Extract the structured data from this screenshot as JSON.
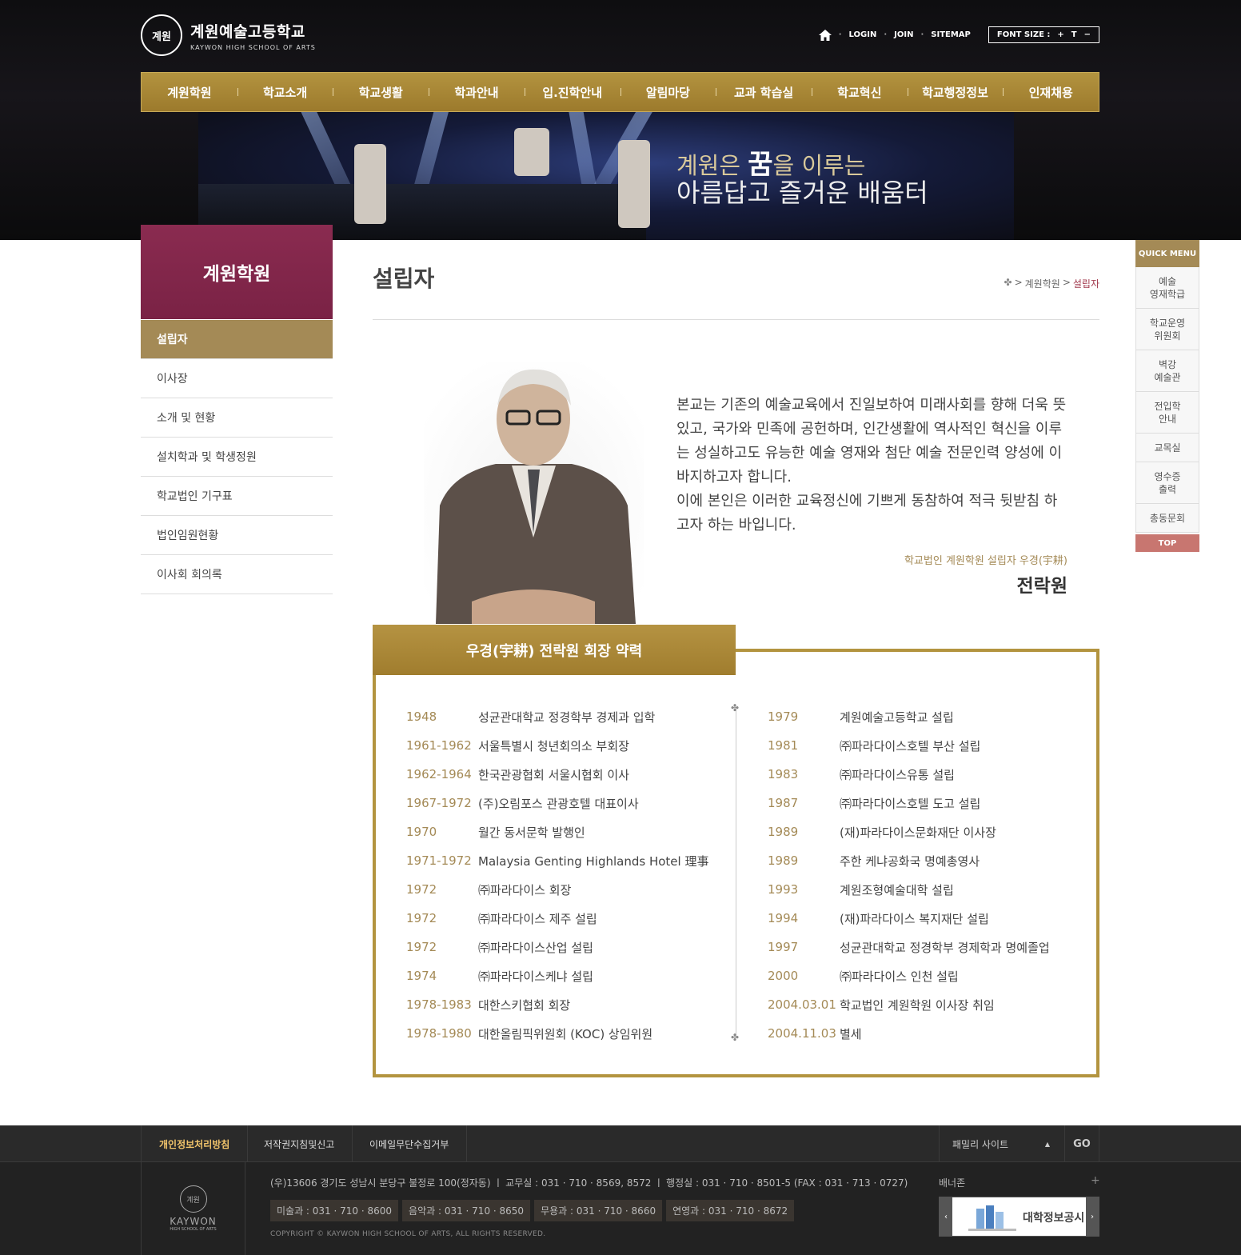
{
  "header": {
    "school_name": "계원예술고등학교",
    "school_name_en": "KAYWON HIGH SCHOOL OF ARTS",
    "emblem_text": "계원",
    "util": {
      "login": "LOGIN",
      "join": "JOIN",
      "sitemap": "SITEMAP",
      "font_size_label": "FONT SIZE :",
      "font_plus": "+",
      "font_reset": "T",
      "font_minus": "−"
    },
    "gnb": [
      "계원학원",
      "학교소개",
      "학교생활",
      "학과안내",
      "입.진학안내",
      "알림마당",
      "교과 학습실",
      "학교혁신",
      "학교행정정보",
      "인재채용"
    ],
    "hero_line1_a": "계원은 ",
    "hero_line1_b": "꿈",
    "hero_line1_c": "을 이루는",
    "hero_line2": "아름답고 즐거운 배움터"
  },
  "sidebar": {
    "title": "계원학원",
    "items": [
      "설립자",
      "이사장",
      "소개 및 현황",
      "설치학과 및 학생정원",
      "학교법인 기구표",
      "법인임원현황",
      "이사회 회의록"
    ],
    "active_index": 0
  },
  "page": {
    "title": "설립자",
    "breadcrumb": [
      ">",
      "계원학원",
      ">",
      "설립자"
    ]
  },
  "message": {
    "paragraph1": "본교는 기존의 예술교육에서 진일보하여 미래사회를 향해 더욱 뜻있고, 국가와 민족에 공헌하며, 인간생활에 역사적인 혁신을 이루는 성실하고도 유능한 예술 영재와 첨단 예술 전문인력 양성에 이바지하고자 합니다.",
    "paragraph2": "이에 본인은 이러한 교육정신에 기쁘게 동참하여 적극 뒷받침 하고자 하는 바입니다.",
    "signature_title": "학교법인 계원학원 설립자 우경(宇耕)",
    "signature_name": "전락원"
  },
  "career": {
    "title": "우경(宇耕) 전락원 회장 약력",
    "left": [
      {
        "year": "1948",
        "text": "성균관대학교 정경학부 경제과 입학"
      },
      {
        "year": "1961-1962",
        "text": "서울특별시 청년회의소 부회장"
      },
      {
        "year": "1962-1964",
        "text": "한국관광협회 서울시협회 이사"
      },
      {
        "year": "1967-1972",
        "text": "(주)오림포스 관광호텔 대표이사"
      },
      {
        "year": "1970",
        "text": "월간 동서문학 발행인"
      },
      {
        "year": "1971-1972",
        "text": "Malaysia Genting Highlands Hotel 理事"
      },
      {
        "year": "1972",
        "text": "㈜파라다이스 회장"
      },
      {
        "year": "1972",
        "text": "㈜파라다이스 제주 설립"
      },
      {
        "year": "1972",
        "text": "㈜파라다이스산업 설립"
      },
      {
        "year": "1974",
        "text": "㈜파라다이스케냐 설립"
      },
      {
        "year": "1978-1983",
        "text": "대한스키협회 회장"
      },
      {
        "year": "1978-1980",
        "text": "대한올림픽위원회 (KOC) 상임위원"
      }
    ],
    "right": [
      {
        "year": "1979",
        "text": "계원예술고등학교 설립"
      },
      {
        "year": "1981",
        "text": "㈜파라다이스호텔 부산 설립"
      },
      {
        "year": "1983",
        "text": "㈜파라다이스유통 설립"
      },
      {
        "year": "1987",
        "text": "㈜파라다이스호텔 도고 설립"
      },
      {
        "year": "1989",
        "text": "(재)파라다이스문화재단 이사장"
      },
      {
        "year": "1989",
        "text": "주한 케냐공화국 명예총영사"
      },
      {
        "year": "1993",
        "text": "계원조형예술대학 설립"
      },
      {
        "year": "1994",
        "text": "(재)파라다이스 복지재단 설립"
      },
      {
        "year": "1997",
        "text": "성균관대학교 정경학부 경제학과 명예졸업"
      },
      {
        "year": "2000",
        "text": "㈜파라다이스 인천 설립"
      },
      {
        "year": "2004.03.01",
        "text": "학교법인 계원학원 이사장 취임"
      },
      {
        "year": "2004.11.03",
        "text": "별세"
      }
    ]
  },
  "quick_menu": {
    "header": "QUICK MENU",
    "items": [
      "예술\n영재학급",
      "학교운영\n위원회",
      "벽강\n예술관",
      "전입학\n안내",
      "교목실",
      "영수증\n출력",
      "총동문회"
    ],
    "top": "TOP"
  },
  "footer": {
    "links": [
      "개인정보처리방침",
      "저작권지침및신고",
      "이메일무단수집거부"
    ],
    "family_site": "패밀리 사이트",
    "go": "GO",
    "logo_emblem": "계원",
    "logo_text": "KAYWON",
    "logo_sub": "HIGH SCHOOL OF ARTS",
    "address": "(우)13606 경기도 성남시 분당구 불정로 100(정자동)   ㅣ  교무실 : 031 · 710 · 8569, 8572   ㅣ  행정실 : 031 · 710 · 8501-5 (FAX : 031 · 713 · 0727)",
    "tels": [
      "미술과 : 031 · 710 · 8600",
      "음악과 : 031 · 710 · 8650",
      "무용과 : 031 · 710 · 8660",
      "연영과 : 031 · 710 · 8672"
    ],
    "copyright": "COPYRIGHT © KAYWON HIGH SCHOOL OF ARTS, ALL RIGHTS RESERVED.",
    "banner_zone": "배너존",
    "banner_plus": "+",
    "banner_text": "대학정보공시",
    "banner_prev": "‹",
    "banner_next": "›"
  },
  "colors": {
    "gold": "#a48a56",
    "burgundy": "#8a2b50",
    "border_gold": "#b3943f"
  }
}
